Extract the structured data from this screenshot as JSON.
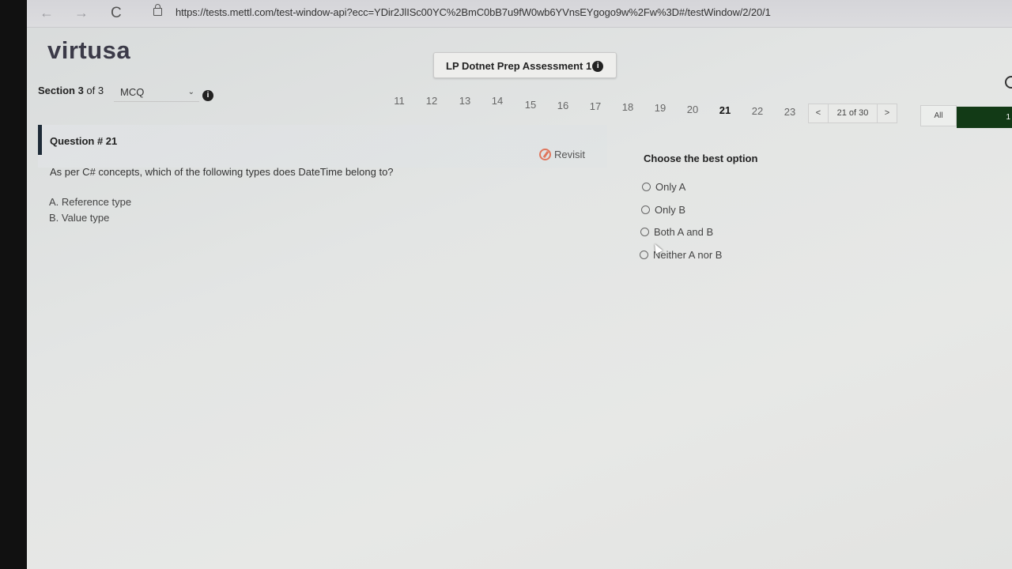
{
  "browser": {
    "url": "https://tests.mettl.com/test-window-api?ecc=YDir2JlISc00YC%2BmC0bB7u9fW0wb6YVnsEYgogo9w%2Fw%3D#/testWindow/2/20/1",
    "back_icon": "←",
    "forward_icon": "→",
    "reload_icon": "C"
  },
  "header": {
    "logo": "virtusa",
    "assessment_title": "LP Dotnet Prep Assessment 1",
    "info_glyph": "i"
  },
  "section": {
    "label_bold": "Section 3",
    "label_rest": " of 3",
    "selected_type": "MCQ",
    "chevron": "⌄"
  },
  "question_nav": {
    "numbers": [
      "11",
      "12",
      "13",
      "14",
      "15",
      "16",
      "17",
      "18",
      "19",
      "20",
      "21",
      "22",
      "23"
    ],
    "current": "21",
    "prev": "<",
    "next": ">",
    "counter": "21 of 30",
    "all_label": "All",
    "right_label": "1"
  },
  "question": {
    "number_label": "Question # 21",
    "revisit_label": "Revisit",
    "text": "As per C# concepts, which of the following types does DateTime belong to?",
    "statements": [
      "A. Reference type",
      "B. Value type"
    ]
  },
  "options": {
    "title": "Choose the best option",
    "items": [
      "Only A",
      "Only B",
      "Both A and B",
      "Neither A nor B"
    ]
  }
}
